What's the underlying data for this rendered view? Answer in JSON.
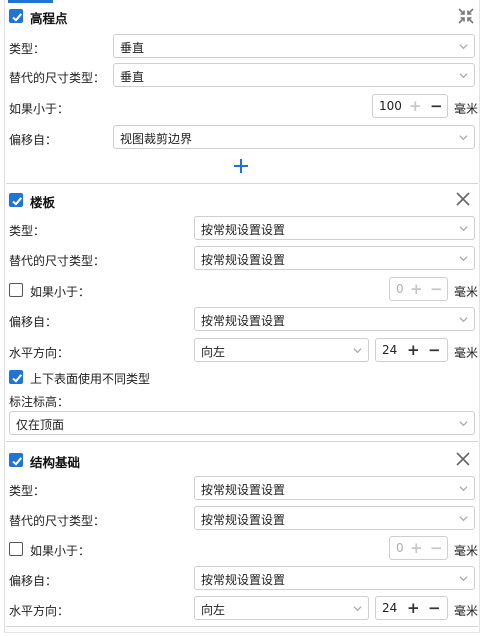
{
  "sections": [
    {
      "title": "高程点",
      "checked": true,
      "header_icon": "collapse-arrows-icon",
      "type_label": "类型：",
      "type_value": "垂直",
      "alt_label": "替代的尺寸类型：",
      "alt_value": "垂直",
      "ifless_label": "如果小于：",
      "ifless_value": "100",
      "unit": "毫米",
      "offset_label": "偏移自：",
      "offset_value": "视图裁剪边界",
      "add_icon": "plus-icon"
    },
    {
      "title": "楼板",
      "checked": true,
      "header_icon": "close-icon",
      "type_label": "类型：",
      "type_value": "按常规设置设置",
      "alt_label": "替代的尺寸类型：",
      "alt_value": "按常规设置设置",
      "ifless_label": "如果小于：",
      "ifless_checked": false,
      "ifless_value": "0",
      "unit": "毫米",
      "offset_label": "偏移自：",
      "offset_value": "按常规设置设置",
      "horiz_label": "水平方向：",
      "horiz_value": "向左",
      "horiz_num": "24",
      "diff_label": "上下表面使用不同类型",
      "diff_checked": true,
      "elev_label": "标注标高：",
      "elev_value": "仅在顶面"
    },
    {
      "title": "结构基础",
      "checked": true,
      "header_icon": "close-icon",
      "type_label": "类型：",
      "type_value": "按常规设置设置",
      "alt_label": "替代的尺寸类型：",
      "alt_value": "按常规设置设置",
      "ifless_label": "如果小于：",
      "ifless_checked": false,
      "ifless_value": "0",
      "unit": "毫米",
      "offset_label": "偏移自：",
      "offset_value": "按常规设置设置",
      "horiz_label": "水平方向：",
      "horiz_value": "向左",
      "horiz_num": "24"
    }
  ],
  "colors": {
    "accent": "#1f74d6",
    "border": "#cfcfcf",
    "disabled": "#c7c7c7"
  }
}
